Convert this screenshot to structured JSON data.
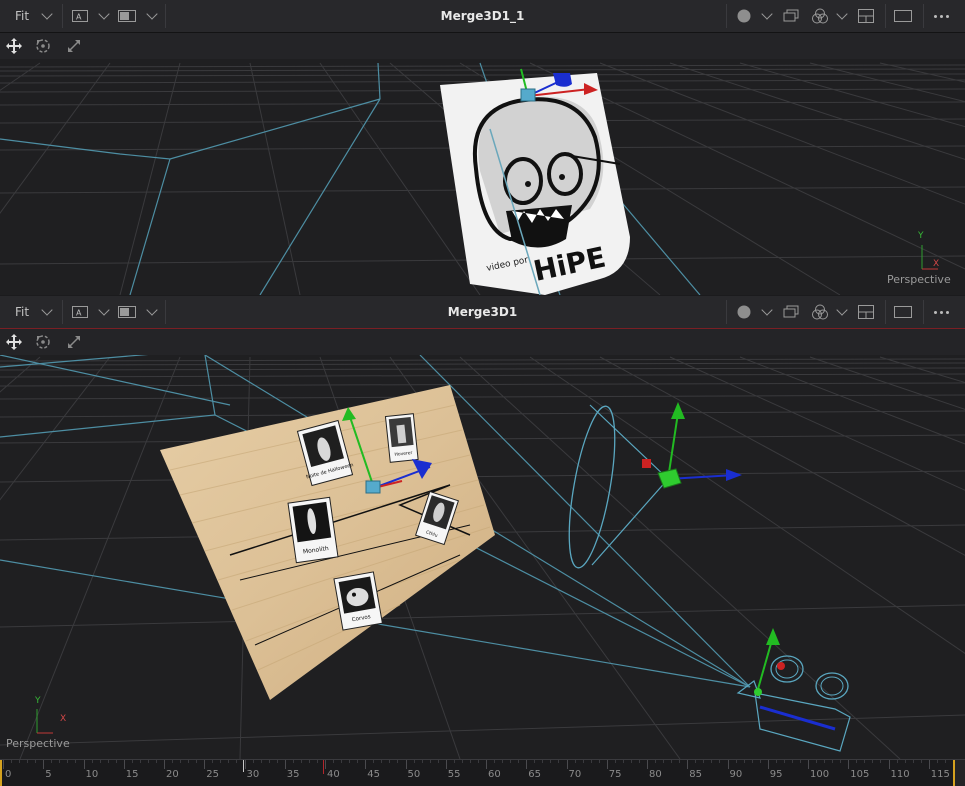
{
  "viewers": [
    {
      "id": "top",
      "title": "Merge3D1_1",
      "fit_label": "Fit",
      "projection_label": "Perspective",
      "axis_y": "Y",
      "axis_x": "X"
    },
    {
      "id": "bottom",
      "title": "Merge3D1",
      "fit_label": "Fit",
      "projection_label": "Perspective",
      "axis_y": "Y",
      "axis_x": "X"
    }
  ],
  "top_card": {
    "line1": "video por",
    "line2": "HiPE"
  },
  "polaroids": [
    {
      "caption": "Noite de Halloween"
    },
    {
      "caption": "Hoverer"
    },
    {
      "caption": "Monolith"
    },
    {
      "caption": "Cthlu"
    },
    {
      "caption": "Corvos"
    }
  ],
  "timeline": {
    "ticks": [
      "0",
      "5",
      "10",
      "15",
      "20",
      "25",
      "30",
      "35",
      "40",
      "45",
      "50",
      "55",
      "60",
      "65",
      "70",
      "75",
      "80",
      "85",
      "90",
      "95",
      "100",
      "105",
      "110",
      "115"
    ],
    "playhead_frame": 30,
    "current_frame_marker": 40
  },
  "colors": {
    "accent_red": "#b3262c",
    "wire_blue": "#5aa7c0",
    "gizmo_green": "#2fcc2f",
    "gizmo_red": "#d82020",
    "gizmo_blue": "#1830d8",
    "timeline_end": "#d5a21f"
  },
  "icons": {
    "header": [
      "chevron-down-icon",
      "channel-a-icon",
      "screen-icon",
      "color-circle-icon",
      "stack-icon",
      "rgb-icon",
      "split-icon",
      "fullscreen-icon",
      "more-icon"
    ],
    "toolbar": [
      "move-icon",
      "rotate-icon",
      "scale-icon"
    ]
  }
}
